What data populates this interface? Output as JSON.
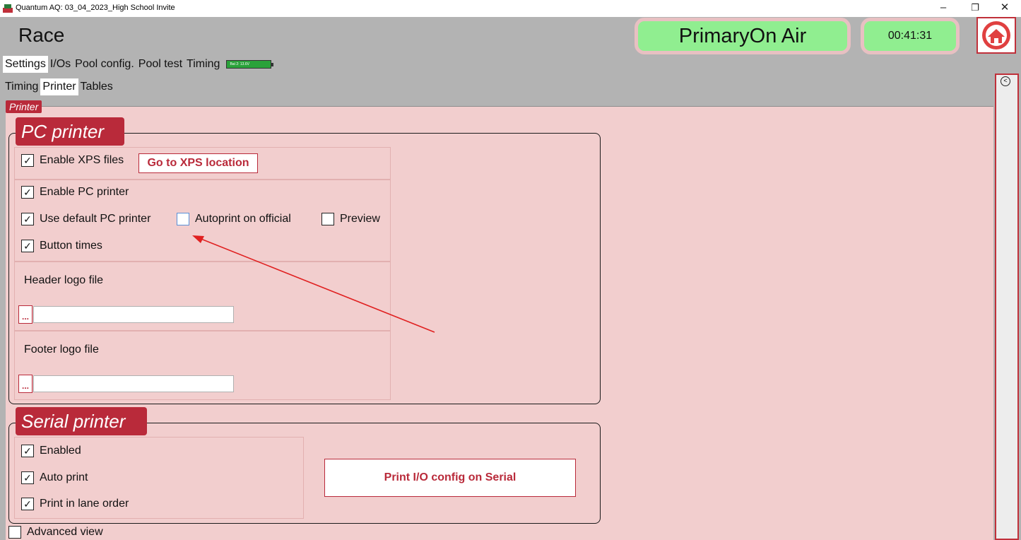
{
  "window": {
    "title": "Quantum AQ: 03_04_2023_High School Invite",
    "minimize_glyph": "–",
    "restore_glyph": "❐",
    "close_glyph": "✕"
  },
  "header": {
    "title": "Race",
    "status_text": "PrimaryOn Air",
    "timer": "00:41:31",
    "status_color": "#90ee90"
  },
  "tabs": {
    "top": [
      "Settings",
      "I/Os",
      "Pool config.",
      "Pool test",
      "Timing"
    ],
    "battery": "Bat 2: 13.6V",
    "sub": [
      "Timing",
      "Printer",
      "Tables"
    ]
  },
  "section_tag": "Printer",
  "pc_printer": {
    "header": "PC printer",
    "enable_xps": "Enable XPS files",
    "goto_xps": "Go to XPS location",
    "enable_pc": "Enable PC printer",
    "use_default": "Use default PC printer",
    "autoprint": "Autoprint on official",
    "preview": "Preview",
    "button_times": "Button times",
    "header_logo": "Header logo file",
    "footer_logo": "Footer logo file",
    "dots": "..."
  },
  "serial_printer": {
    "header": "Serial printer",
    "enabled": "Enabled",
    "auto_print": "Auto print",
    "lane_order": "Print in lane order",
    "print_io": "Print I/O config on Serial"
  },
  "advanced_view": "Advanced view",
  "check_glyph": "✓",
  "accent_color": "#b92a3a"
}
